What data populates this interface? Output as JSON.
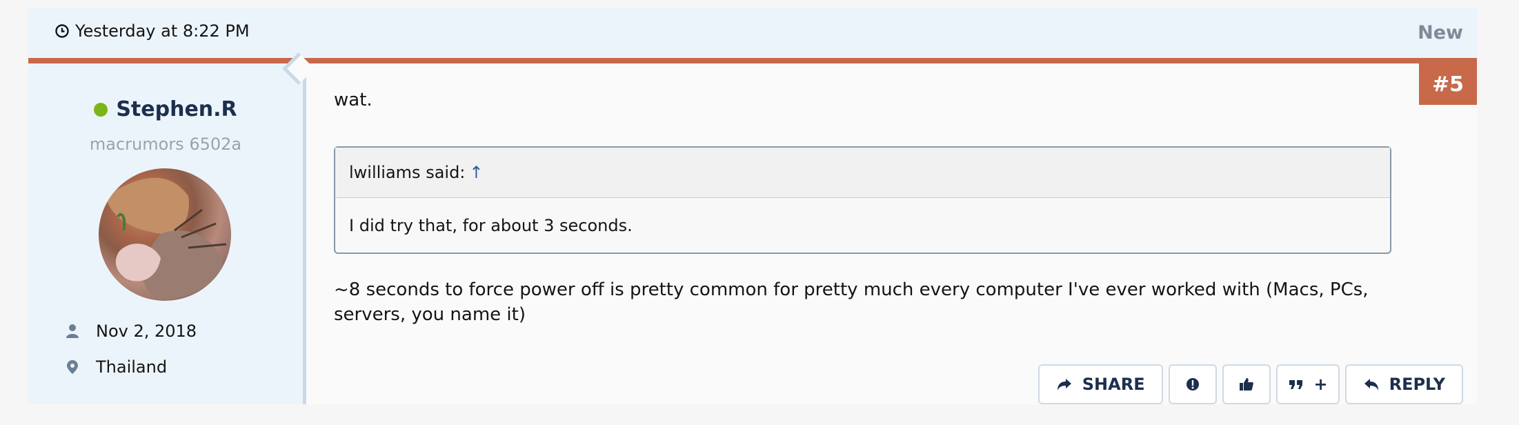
{
  "post": {
    "timestamp": "Yesterday at 8:22 PM",
    "new_label": "New",
    "post_number": "#5"
  },
  "user": {
    "name": "Stephen.R",
    "title": "macrumors 6502a",
    "joined": "Nov 2, 2018",
    "location": "Thailand",
    "online": true,
    "status_color": "#7cb518"
  },
  "message": {
    "first_line": "wat.",
    "quote": {
      "author_said": "lwilliams said:",
      "arrow": "↑",
      "text": "I did try that, for about 3 seconds."
    },
    "body": "~8 seconds to force power off is pretty common for pretty much every computer I've ever worked with (Macs, PCs, servers, you name it)"
  },
  "actions": {
    "share_label": "SHARE",
    "reply_label": "REPLY",
    "report_icon": "exclamation-circle-icon",
    "like_icon": "thumbs-up-icon",
    "multiquote_label": "+"
  },
  "colors": {
    "accent": "#c8694a",
    "header_bg": "#ecf4fb",
    "text_dark": "#1c2f4d"
  }
}
